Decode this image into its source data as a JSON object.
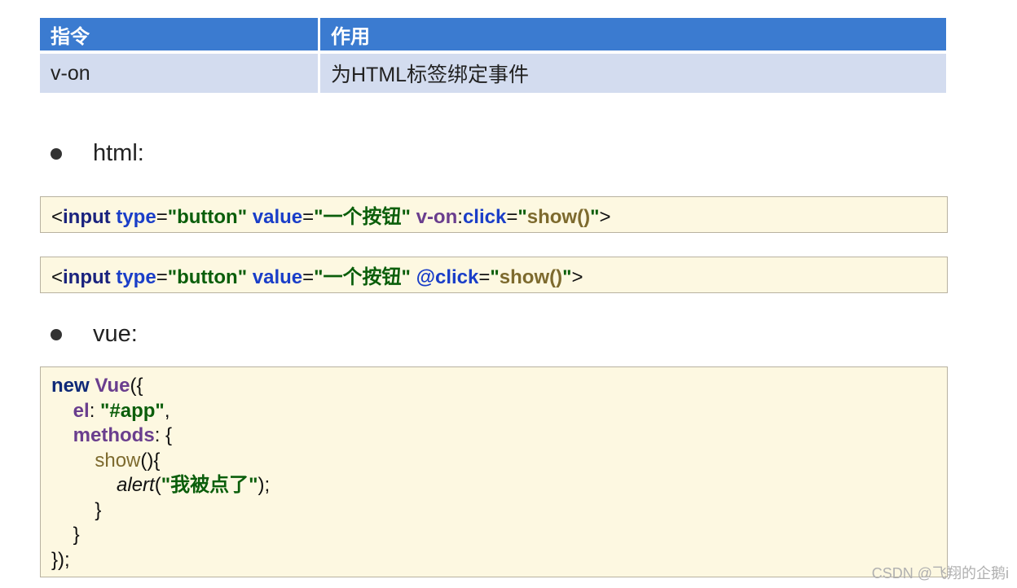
{
  "table": {
    "header": [
      "指令",
      "作用"
    ],
    "rows": [
      [
        "v-on",
        "为HTML标签绑定事件"
      ]
    ]
  },
  "sections": {
    "html_label": "html:",
    "vue_label": "vue:"
  },
  "code1": {
    "lt": "<",
    "tag": "input",
    "type_attr": "type",
    "eq": "=",
    "type_val": "\"button\"",
    "value_attr": "value",
    "value_val": "\"一个按钮\"",
    "dir_von": "v-on",
    "colon": ":",
    "dir_click": "click",
    "handler": "\"show()\"",
    "handler_q1": "\"",
    "handler_fn": "show()",
    "handler_q2": "\"",
    "gt": ">"
  },
  "code2": {
    "dir_at": "@click",
    "gt": ">"
  },
  "code3": {
    "l1_new": "new",
    "l1_vue": "Vue",
    "l1_rest": "({",
    "l2_el": "el",
    "l2_colon": ": ",
    "l2_val": "\"#app\"",
    "l2_comma": ",",
    "l3_methods": "methods",
    "l3_rest": ": {",
    "l4_show": "show",
    "l4_rest": "(){",
    "l5_alert": "alert",
    "l5_open": "(",
    "l5_str": "\"我被点了\"",
    "l5_close": ");",
    "l6": "}",
    "l7": "}",
    "l8": "});"
  },
  "watermark": "CSDN @飞翔的企鹅i",
  "colors": {
    "header_bg": "#3b7bd0",
    "row_bg": "#d3dcef",
    "code_bg": "#fdf8e1",
    "keyword_blue": "#1a3ec8",
    "string_green": "#0b5e0b",
    "purple": "#6a3e8e"
  }
}
